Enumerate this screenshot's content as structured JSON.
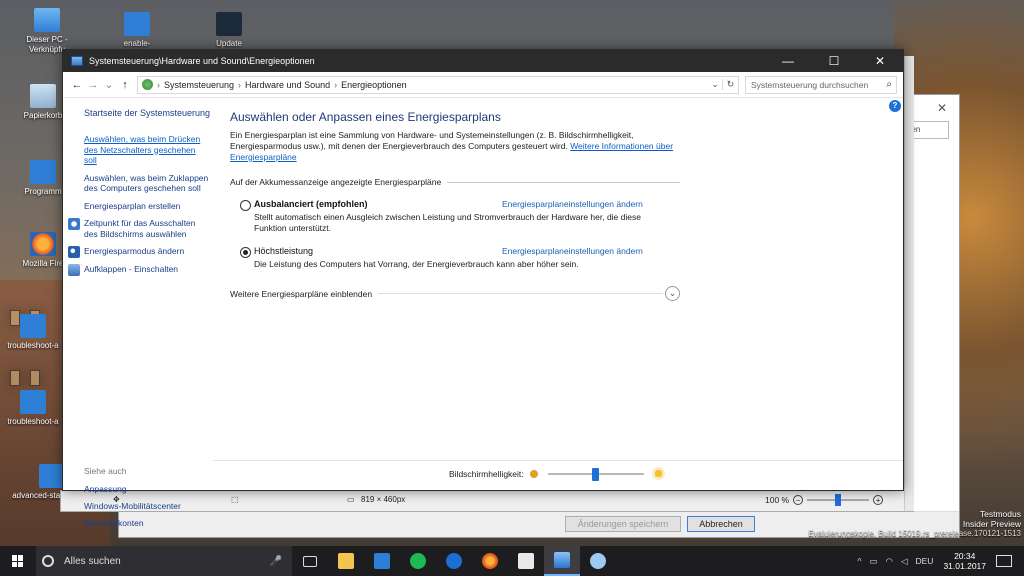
{
  "desktop": {
    "icons": [
      {
        "label": "Dieser PC - Verknüpfu",
        "icon": "this-pc-icon"
      },
      {
        "label": "enable-safemode-n...",
        "icon": "file-icon"
      },
      {
        "label": "Update Reparatur ...",
        "icon": "cmd-icon"
      },
      {
        "label": "Papierkorb",
        "icon": "recycle-bin-icon"
      },
      {
        "label": "Programm",
        "icon": "program-icon"
      },
      {
        "label": "Mozilla Fire",
        "icon": "firefox-icon"
      },
      {
        "label": "troubleshoot-a",
        "icon": "file-icon"
      },
      {
        "label": "troubleshoot-a",
        "icon": "file-icon"
      },
      {
        "label": "advanced-startup-se...",
        "icon": "file-icon"
      }
    ]
  },
  "window": {
    "title": "Systemsteuerung\\Hardware und Sound\\Energieoptionen",
    "buttons": {
      "minimize": "—",
      "maximize": "☐",
      "close": "✕"
    }
  },
  "address": {
    "crumbs": [
      "Systemsteuerung",
      "Hardware und Sound",
      "Energieoptionen"
    ],
    "separator": "›",
    "search_placeholder": "Systemsteuerung durchsuchen"
  },
  "sidebar": {
    "home": "Startseite der Systemsteuerung",
    "links": [
      {
        "label": "Auswählen, was beim Drücken des Netzschalters geschehen soll"
      },
      {
        "label": "Auswählen, was beim Zuklappen des Computers geschehen soll"
      },
      {
        "label": "Energiesparplan erstellen"
      },
      {
        "label": "Zeitpunkt für das Ausschalten des Bildschirms auswählen"
      },
      {
        "label": "Energiesparmodus ändern"
      },
      {
        "label": "Aufklappen - Einschalten"
      }
    ],
    "see_also_heading": "Siehe auch",
    "see_also": [
      "Anpassung",
      "Windows-Mobilitätscenter",
      "Benutzerkonten"
    ]
  },
  "main": {
    "heading": "Auswählen oder Anpassen eines Energiesparplans",
    "intro": "Ein Energiesparplan ist eine Sammlung von Hardware- und Systemeinstellungen (z. B. Bildschirmhelligkeit, Energiesparmodus usw.), mit denen der Energieverbrauch des Computers gesteuert wird.",
    "intro_link": "Weitere Informationen über Energiesparpläne",
    "group_label": "Auf der Akkumessanzeige angezeigte Energiesparpläne",
    "plans": [
      {
        "name": "Ausbalanciert (empfohlen)",
        "selected": false,
        "description": "Stellt automatisch einen Ausgleich zwischen Leistung und Stromverbrauch der Hardware her, die diese Funktion unterstützt.",
        "link": "Energiesparplaneinstellungen ändern"
      },
      {
        "name": "Höchstleistung",
        "selected": true,
        "description": "Die Leistung des Computers hat Vorrang, der Energieverbrauch kann aber höher sein.",
        "link": "Energiesparplaneinstellungen ändern"
      }
    ],
    "more_plans": "Weitere Energiesparpläne einblenden"
  },
  "brightness": {
    "label": "Bildschirmhelligkeit:",
    "value_fraction": 0.5
  },
  "bg_window": {
    "search_text": "hen",
    "save_button": "Änderungen speichern",
    "cancel_button": "Abbrechen"
  },
  "statusbar": {
    "dimensions": "819 × 460px",
    "zoom": "100 %"
  },
  "watermark": {
    "line1": "Testmodus",
    "line2": "Insider Preview",
    "line3": "Evaluierungskopie. Build 15019.rs_prerelease.170121-1513"
  },
  "taskbar": {
    "search": "Alles suchen",
    "language": "DEU",
    "time": "20:34",
    "date": "31.01.2017"
  }
}
